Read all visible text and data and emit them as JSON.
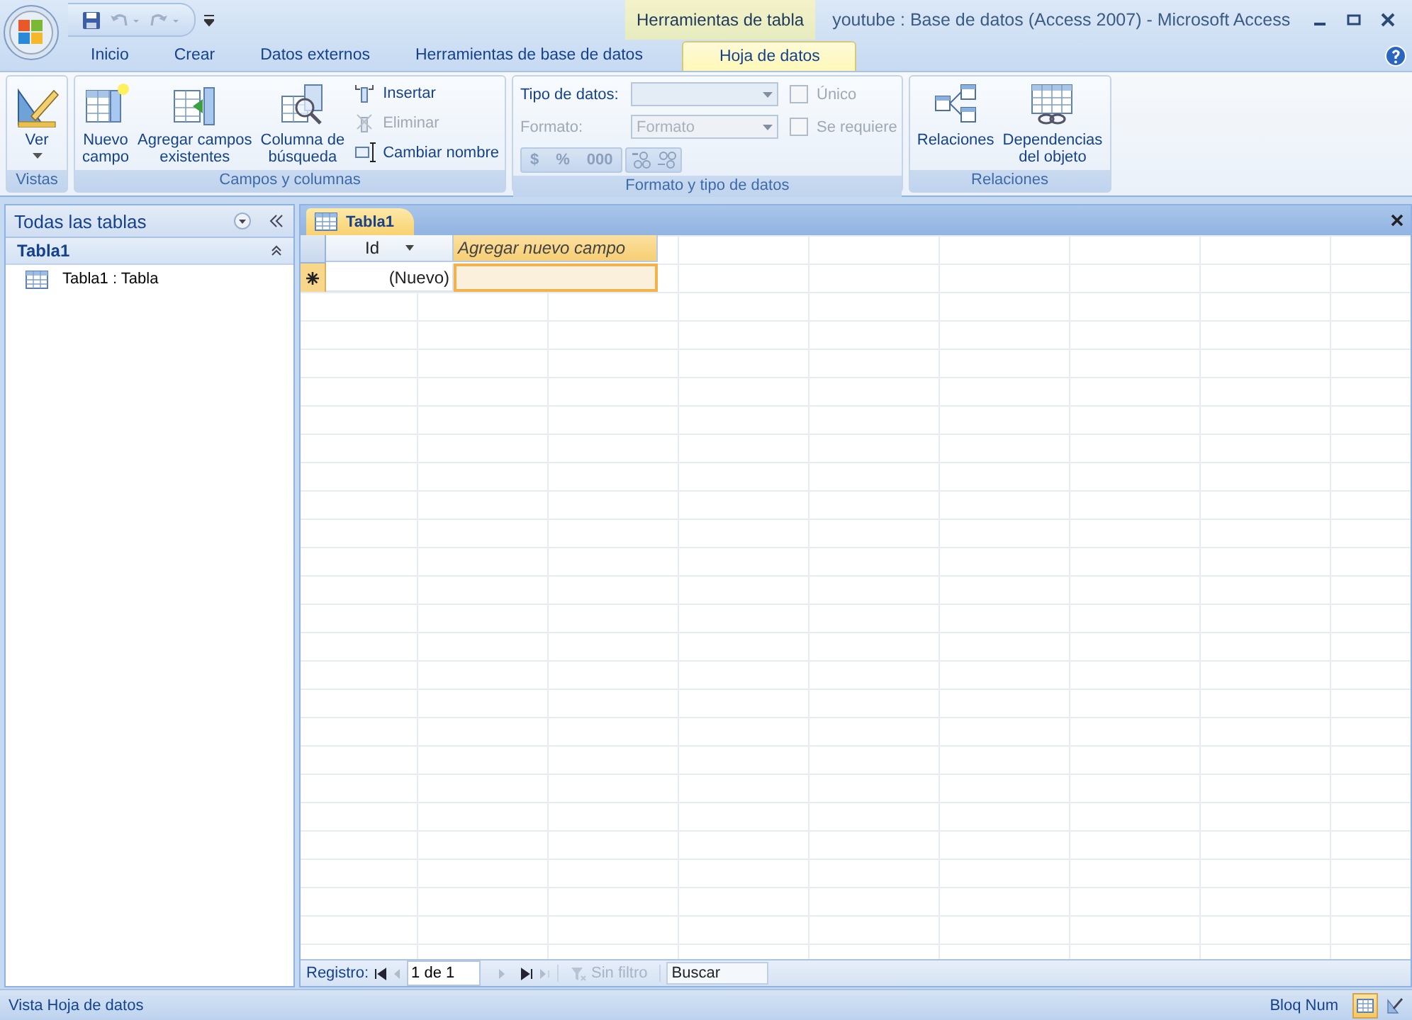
{
  "window": {
    "title": "youtube : Base de datos (Access 2007) - Microsoft Access",
    "context_group": "Herramientas de tabla"
  },
  "ribbon_tabs": [
    {
      "label": "Inicio",
      "selected": false
    },
    {
      "label": "Crear",
      "selected": false
    },
    {
      "label": "Datos externos",
      "selected": false
    },
    {
      "label": "Herramientas de base de datos",
      "selected": false
    },
    {
      "label": "Hoja de datos",
      "selected": true
    }
  ],
  "ribbon_groups": [
    {
      "label": "Vistas",
      "items": [
        {
          "kind": "large",
          "label": "Ver",
          "dropdown": true
        }
      ]
    },
    {
      "label": "Campos y columnas",
      "items": [
        {
          "kind": "large",
          "label": "Nuevo\ncampo"
        },
        {
          "kind": "large",
          "label": "Agregar campos\nexistentes"
        },
        {
          "kind": "large",
          "label": "Columna de\nbúsqueda"
        },
        {
          "kind": "small",
          "label": "Insertar",
          "disabled": false
        },
        {
          "kind": "small",
          "label": "Eliminar",
          "disabled": true
        },
        {
          "kind": "small",
          "label": "Cambiar nombre",
          "disabled": false
        }
      ]
    },
    {
      "label": "Formato y tipo de datos",
      "items": [
        {
          "kind": "dropdown",
          "label": "Tipo de datos:",
          "disabled": false
        },
        {
          "kind": "dropdown",
          "label": "Formato:",
          "placeholder": "Formato",
          "disabled": true
        },
        {
          "kind": "buttons",
          "labels": [
            "$",
            "%",
            "000"
          ]
        },
        {
          "kind": "checkbox",
          "label": "Único",
          "checked": false,
          "disabled": true
        },
        {
          "kind": "checkbox",
          "label": "Se requiere",
          "checked": false,
          "disabled": true
        }
      ]
    },
    {
      "label": "Relaciones",
      "items": [
        {
          "kind": "large",
          "label": "Relaciones"
        },
        {
          "kind": "large",
          "label": "Dependencias\ndel objeto"
        }
      ]
    }
  ],
  "nav_pane": {
    "title": "Todas las tablas",
    "groups": [
      {
        "label": "Tabla1",
        "expanded": true,
        "items": [
          {
            "label": "Tabla1 : Tabla"
          }
        ]
      }
    ]
  },
  "document_tabs": [
    {
      "label": "Tabla1",
      "selected": true
    }
  ],
  "datasheet": {
    "columns": [
      {
        "label": "Id",
        "dropdown": true,
        "selected": false
      },
      {
        "label": "Agregar nuevo campo",
        "dropdown": false,
        "selected": true
      }
    ],
    "rows": [
      {
        "new": true,
        "cells": [
          "(Nuevo)",
          ""
        ]
      }
    ]
  },
  "record_nav": {
    "label": "Registro:",
    "position": "1 de 1",
    "filter": "Sin filtro",
    "search_placeholder": "Buscar"
  },
  "status_bar": {
    "text": "Vista Hoja de datos",
    "indicator": "Bloq Num",
    "views": [
      {
        "selected": true
      },
      {
        "selected": false
      }
    ]
  }
}
